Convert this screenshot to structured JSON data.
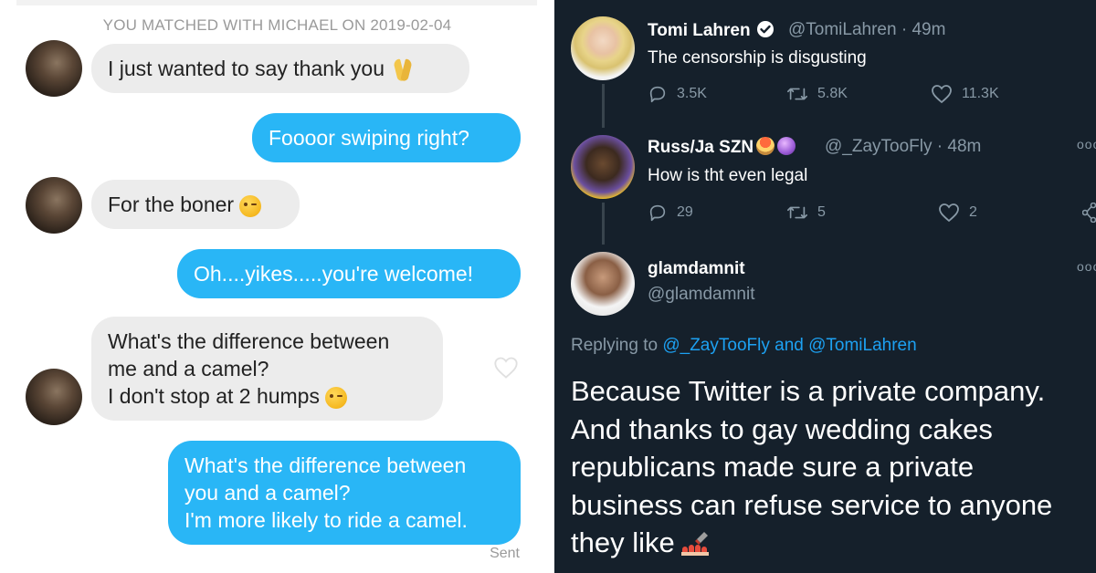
{
  "left_chat": {
    "match_banner": "YOU MATCHED WITH MICHAEL ON 2019-02-04",
    "messages": [
      {
        "from": "them",
        "lines": [
          "I just wanted to say thank you"
        ],
        "emoji": "folded-hands"
      },
      {
        "from": "me",
        "lines": [
          "Foooor swiping right?"
        ]
      },
      {
        "from": "them",
        "lines": [
          "For the boner"
        ],
        "emoji": "winking-face"
      },
      {
        "from": "me",
        "lines": [
          "Oh....yikes.....you're welcome!"
        ]
      },
      {
        "from": "them",
        "lines": [
          "What's the difference between",
          "me and a camel?",
          "I don't stop at 2 humps"
        ],
        "emoji": "winking-face"
      },
      {
        "from": "me",
        "lines": [
          "What's the difference between",
          "you and a camel?",
          "I'm more likely to ride a camel."
        ]
      }
    ],
    "sent_label": "Sent",
    "colors": {
      "incoming": "#ececec",
      "outgoing": "#29b6f6"
    }
  },
  "right_twitter": {
    "tweets": [
      {
        "name": "Tomi Lahren",
        "handle": "@TomiLahren",
        "time": "49m",
        "text": "The censorship is disgusting",
        "replies": "3.5K",
        "retweets": "5.8K",
        "likes": "11.3K"
      },
      {
        "name": "Russ/Ja SZN",
        "handle": "@_ZayTooFly",
        "time": "48m",
        "text": "How is tht even legal",
        "replies": "29",
        "retweets": "5",
        "likes": "2"
      }
    ],
    "reply": {
      "name": "glamdamnit",
      "handle": "@glamdamnit",
      "replying_prefix": "Replying to",
      "mention1": "@_ZayTooFly",
      "conj": "and",
      "mention2": "@TomiLahren",
      "lines": [
        "Because Twitter is a private company.",
        "And thanks to gay wedding cakes",
        "republicans made sure a private",
        "business can refuse service to anyone",
        "they like"
      ],
      "emoji": "nail-polish"
    },
    "more_glyph": "ooo",
    "colors": {
      "background": "#15202b",
      "muted": "#8899a6",
      "link": "#1da1f2"
    }
  }
}
